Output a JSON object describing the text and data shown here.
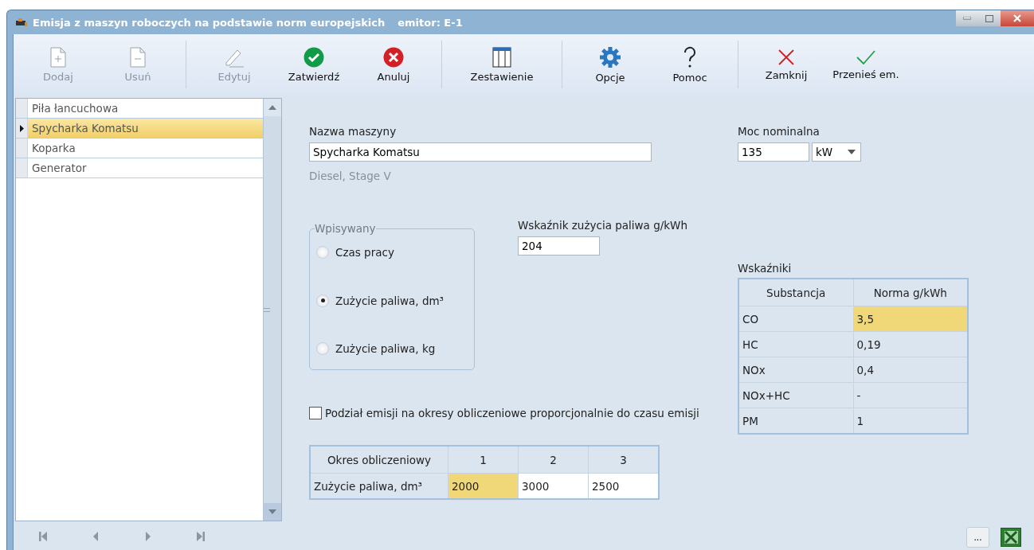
{
  "window": {
    "title": "Emisja z maszyn roboczych na podstawie norm europejskich",
    "subtitle": "emitor: E-1"
  },
  "toolbar": [
    [
      {
        "kind": "add",
        "label": "Dodaj",
        "disabled": true
      },
      {
        "kind": "remove",
        "label": "Usuń",
        "disabled": true
      }
    ],
    [
      {
        "kind": "edit",
        "label": "Edytuj",
        "disabled": true
      },
      {
        "kind": "confirm",
        "label": "Zatwierdź",
        "disabled": false
      },
      {
        "kind": "cancel",
        "label": "Anuluj",
        "disabled": false
      }
    ],
    [
      {
        "kind": "table",
        "label": "Zestawienie",
        "disabled": false
      }
    ],
    [
      {
        "kind": "settings",
        "label": "Opcje",
        "disabled": false
      },
      {
        "kind": "help",
        "label": "Pomoc",
        "disabled": false
      }
    ],
    [
      {
        "kind": "close",
        "label": "Zamknij",
        "disabled": false
      },
      {
        "kind": "check",
        "label": "Przenieś em.",
        "disabled": false
      }
    ]
  ],
  "machines": [
    {
      "name": "Piła łancuchowa",
      "selected": false
    },
    {
      "name": "Spycharka Komatsu",
      "selected": true
    },
    {
      "name": "Koparka",
      "selected": false
    },
    {
      "name": "Generator",
      "selected": false
    }
  ],
  "name_field": {
    "label": "Nazwa maszyny",
    "value": "Spycharka Komatsu",
    "note": "Diesel, Stage V"
  },
  "power": {
    "label": "Moc nominalna",
    "value": "135",
    "unit": "kW"
  },
  "input_mode": {
    "title": "Wpisywany",
    "options": [
      {
        "label": "Czas pracy",
        "selected": false
      },
      {
        "label": "Zużycie paliwa, dm³",
        "selected": true
      },
      {
        "label": "Zużycie paliwa, kg",
        "selected": false
      }
    ]
  },
  "fuel_index": {
    "label": "Wskaźnik zużycia paliwa g/kWh",
    "value": "204"
  },
  "split_checkbox": {
    "label": "Podział emisji na okresy obliczeniowe proporcjonalnie do czasu emisji",
    "checked": false
  },
  "periods": {
    "header": "Okres obliczeniowy",
    "columns": [
      "1",
      "2",
      "3"
    ],
    "row_label": "Zużycie paliwa, dm³",
    "cells": [
      {
        "value": "2000",
        "selected": true
      },
      {
        "value": "3000",
        "selected": false
      },
      {
        "value": "2500",
        "selected": false
      }
    ]
  },
  "indicators": {
    "title": "Wskaźniki",
    "columns": [
      "Substancja",
      "Norma g/kWh"
    ],
    "rows": [
      {
        "substance": "CO",
        "norm": "3,5",
        "selected": true
      },
      {
        "substance": "HC",
        "norm": "0,19",
        "selected": false
      },
      {
        "substance": "NOx",
        "norm": "0,4",
        "selected": false
      },
      {
        "substance": "NOx+HC",
        "norm": "-",
        "selected": false
      },
      {
        "substance": "PM",
        "norm": "1",
        "selected": false
      }
    ]
  },
  "more_button": "..."
}
